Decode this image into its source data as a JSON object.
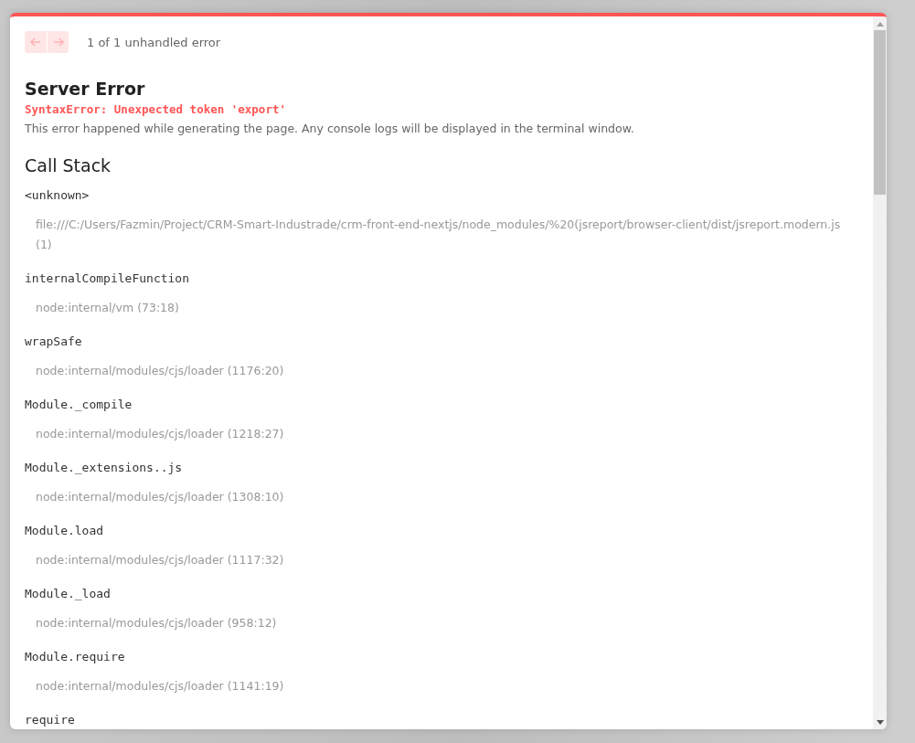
{
  "nav": {
    "buttons": [
      {
        "kind": "previous",
        "disabled": true
      },
      {
        "kind": "next",
        "disabled": true
      }
    ],
    "counter": "1 of 1 unhandled error"
  },
  "error": {
    "title": "Server Error",
    "message": "SyntaxError: Unexpected token 'export'",
    "description": "This error happened while generating the page. Any console logs will be displayed in the terminal window."
  },
  "call_stack": {
    "heading": "Call Stack",
    "frames": [
      {
        "function": "<unknown>",
        "location": "file:///C:/Users/Fazmin/Project/CRM-Smart-Industrade/crm-front-end-nextjs/node_modules/%20(jsreport/browser-client/dist/jsreport.modern.js (1)"
      },
      {
        "function": "internalCompileFunction",
        "location": "node:internal/vm (73:18)"
      },
      {
        "function": "wrapSafe",
        "location": "node:internal/modules/cjs/loader (1176:20)"
      },
      {
        "function": "Module._compile",
        "location": "node:internal/modules/cjs/loader (1218:27)"
      },
      {
        "function": "Module._extensions..js",
        "location": "node:internal/modules/cjs/loader (1308:10)"
      },
      {
        "function": "Module.load",
        "location": "node:internal/modules/cjs/loader (1117:32)"
      },
      {
        "function": "Module._load",
        "location": "node:internal/modules/cjs/loader (958:12)"
      },
      {
        "function": "Module.require",
        "location": "node:internal/modules/cjs/loader (1141:19)"
      },
      {
        "function": "require"
      }
    ]
  }
}
